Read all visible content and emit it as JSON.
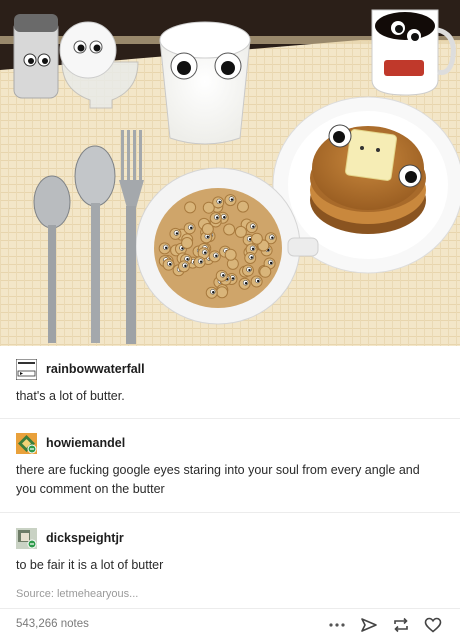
{
  "post": {
    "replies": [
      {
        "username": "rainbowwaterfall",
        "text": "that's a lot of butter."
      },
      {
        "username": "howiemandel",
        "text": "there are fucking google eyes staring into your soul from every angle and you comment on the butter"
      },
      {
        "username": "dickspeightjr",
        "text": "to be fair it is a lot of butter"
      }
    ],
    "source_label": "Source:",
    "source_value": "letmehearyous...",
    "notes": "543,266 notes"
  },
  "icons": {
    "more": "more-dots-icon",
    "share": "share-arrow-icon",
    "reblog": "reblog-icon",
    "like": "heart-icon"
  },
  "colors": {
    "placemat": "#f1e3c4",
    "table": "#2b1f18",
    "text": "#2a2a2a",
    "muted": "#9a9a9a"
  }
}
